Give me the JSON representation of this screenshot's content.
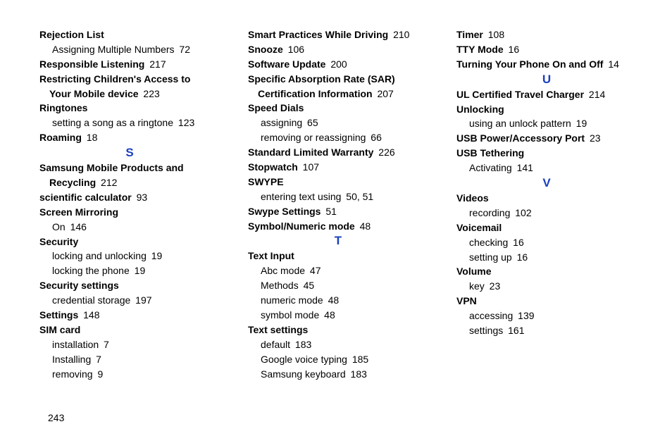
{
  "pageNumber": "243",
  "letters": {
    "S": "S",
    "T": "T",
    "U": "U",
    "V": "V"
  },
  "col1": [
    {
      "type": "bold",
      "text": "Rejection List"
    },
    {
      "type": "sub",
      "text": "Assigning Multiple Numbers",
      "pg": "72"
    },
    {
      "type": "bold",
      "text": "Responsible Listening",
      "pg": "217"
    },
    {
      "type": "bold",
      "text": "Restricting Children's Access to"
    },
    {
      "type": "subbold",
      "text": "Your Mobile device",
      "pg": "223"
    },
    {
      "type": "bold",
      "text": "Ringtones"
    },
    {
      "type": "sub",
      "text": "setting a song as a ringtone",
      "pg": "123"
    },
    {
      "type": "bold",
      "text": "Roaming",
      "pg": "18"
    },
    {
      "type": "letter",
      "key": "S"
    },
    {
      "type": "bold",
      "text": "Samsung Mobile Products and"
    },
    {
      "type": "subbold",
      "text": "Recycling",
      "pg": "212"
    },
    {
      "type": "bold",
      "text": "scientific calculator",
      "pg": "93"
    },
    {
      "type": "bold",
      "text": "Screen Mirroring"
    },
    {
      "type": "sub",
      "text": "On",
      "pg": "146"
    },
    {
      "type": "bold",
      "text": "Security"
    },
    {
      "type": "sub",
      "text": "locking and unlocking",
      "pg": "19"
    },
    {
      "type": "sub",
      "text": "locking the phone",
      "pg": "19"
    },
    {
      "type": "bold",
      "text": "Security settings"
    },
    {
      "type": "sub",
      "text": "credential storage",
      "pg": "197"
    },
    {
      "type": "bold",
      "text": "Settings",
      "pg": "148"
    },
    {
      "type": "bold",
      "text": "SIM card"
    },
    {
      "type": "sub",
      "text": "installation",
      "pg": "7"
    },
    {
      "type": "sub",
      "text": "Installing",
      "pg": "7"
    },
    {
      "type": "sub",
      "text": "removing",
      "pg": "9"
    }
  ],
  "col2": [
    {
      "type": "bold",
      "text": "Smart Practices While Driving",
      "pg": "210"
    },
    {
      "type": "bold",
      "text": "Snooze",
      "pg": "106"
    },
    {
      "type": "bold",
      "text": "Software Update",
      "pg": "200"
    },
    {
      "type": "bold",
      "text": "Specific Absorption Rate (SAR)"
    },
    {
      "type": "subbold",
      "text": "Certification Information",
      "pg": "207"
    },
    {
      "type": "bold",
      "text": "Speed Dials"
    },
    {
      "type": "sub",
      "text": "assigning",
      "pg": "65"
    },
    {
      "type": "sub",
      "text": "removing or reassigning",
      "pg": "66"
    },
    {
      "type": "bold",
      "text": "Standard Limited Warranty",
      "pg": "226"
    },
    {
      "type": "bold",
      "text": "Stopwatch",
      "pg": "107"
    },
    {
      "type": "bold",
      "text": "SWYPE"
    },
    {
      "type": "sub",
      "text": "entering text using",
      "pg": "50, 51"
    },
    {
      "type": "bold",
      "text": "Swype Settings",
      "pg": "51"
    },
    {
      "type": "bold",
      "text": "Symbol/Numeric mode",
      "pg": "48"
    },
    {
      "type": "letter",
      "key": "T"
    },
    {
      "type": "bold",
      "text": "Text Input"
    },
    {
      "type": "sub",
      "text": "Abc mode",
      "pg": "47"
    },
    {
      "type": "sub",
      "text": "Methods",
      "pg": "45"
    },
    {
      "type": "sub",
      "text": "numeric mode",
      "pg": "48"
    },
    {
      "type": "sub",
      "text": "symbol mode",
      "pg": "48"
    },
    {
      "type": "bold",
      "text": "Text settings"
    },
    {
      "type": "sub",
      "text": "default",
      "pg": "183"
    },
    {
      "type": "sub",
      "text": "Google voice typing",
      "pg": "185"
    },
    {
      "type": "sub",
      "text": "Samsung keyboard",
      "pg": "183"
    }
  ],
  "col3": [
    {
      "type": "bold",
      "text": "Timer",
      "pg": "108"
    },
    {
      "type": "bold",
      "text": "TTY Mode",
      "pg": "16"
    },
    {
      "type": "bold",
      "text": "Turning Your Phone On and Off",
      "pg": "14"
    },
    {
      "type": "letter",
      "key": "U"
    },
    {
      "type": "bold",
      "text": "UL Certified Travel Charger",
      "pg": "214"
    },
    {
      "type": "bold",
      "text": "Unlocking"
    },
    {
      "type": "sub",
      "text": "using an unlock pattern",
      "pg": "19"
    },
    {
      "type": "bold",
      "text": "USB Power/Accessory Port",
      "pg": "23"
    },
    {
      "type": "bold",
      "text": "USB Tethering"
    },
    {
      "type": "sub",
      "text": "Activating",
      "pg": "141"
    },
    {
      "type": "letter",
      "key": "V"
    },
    {
      "type": "bold",
      "text": "Videos"
    },
    {
      "type": "sub",
      "text": "recording",
      "pg": "102"
    },
    {
      "type": "bold",
      "text": "Voicemail"
    },
    {
      "type": "sub",
      "text": "checking",
      "pg": "16"
    },
    {
      "type": "sub",
      "text": "setting up",
      "pg": "16"
    },
    {
      "type": "bold",
      "text": "Volume"
    },
    {
      "type": "sub",
      "text": "key",
      "pg": "23"
    },
    {
      "type": "bold",
      "text": "VPN"
    },
    {
      "type": "sub",
      "text": "accessing",
      "pg": "139"
    },
    {
      "type": "sub",
      "text": "settings",
      "pg": "161"
    }
  ]
}
